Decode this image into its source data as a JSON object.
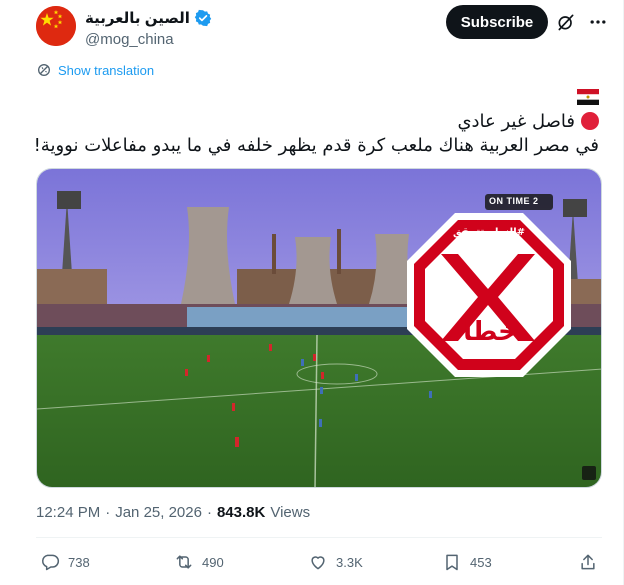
{
  "author": {
    "display_name": "الصين بالعربية",
    "handle": "@mog_china",
    "verified": true
  },
  "header": {
    "subscribe_label": "Subscribe",
    "icons": [
      "grok-icon",
      "more-options-icon"
    ]
  },
  "translation": {
    "label": "Show translation"
  },
  "tweet": {
    "flag": "egypt-flag",
    "line1": "فاصل غير عادي",
    "line2": "في مصر العربية هناك ملعب كرة قدم يظهر خلفه في ما يبدو مفاعلات نووية!"
  },
  "media": {
    "broadcaster_logo": "ON TIME 2",
    "stamp_top": "#النهار_تتحقق",
    "stamp_letter": "X",
    "stamp_word": "خطأ",
    "stamp_color": "#d0021b"
  },
  "meta": {
    "time": "12:24 PM",
    "date": "Jan 25, 2026",
    "separator": "·",
    "views_count": "843.8K",
    "views_label": "Views"
  },
  "actions": {
    "replies": "738",
    "reposts": "490",
    "likes": "3.3K",
    "bookmarks": "453"
  },
  "colors": {
    "accent": "#1d9bf0",
    "text": "#0f1419",
    "muted": "#536471"
  }
}
